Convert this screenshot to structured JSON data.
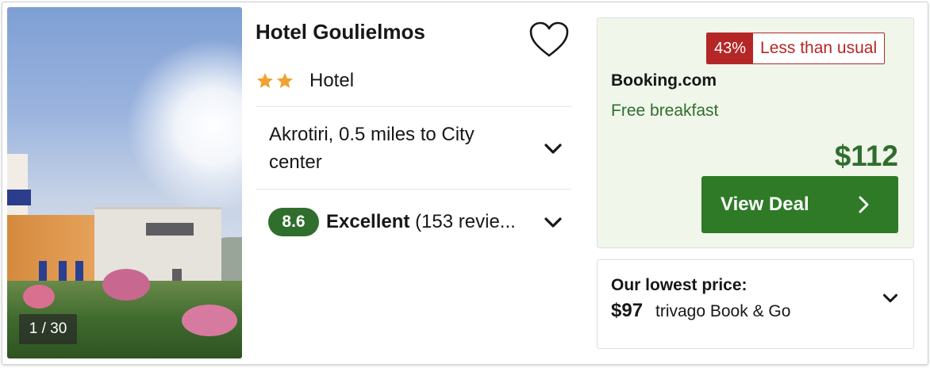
{
  "photo": {
    "counter": "1 / 30"
  },
  "hotel": {
    "name": "Hotel Goulielmos",
    "stars": 2,
    "type": "Hotel",
    "location": "Akrotiri, 0.5 miles to City center",
    "rating": {
      "score": "8.6",
      "label": "Excellent",
      "reviews": "(153 revie..."
    }
  },
  "deal": {
    "discount_pct": "43%",
    "discount_text": "Less than usual",
    "provider": "Booking.com",
    "perk": "Free breakfast",
    "price": "$112",
    "button_label": "View Deal"
  },
  "lowest": {
    "label": "Our lowest price:",
    "price": "$97",
    "source": "trivago Book & Go"
  },
  "colors": {
    "price_green": "#2f6e2d",
    "button_green": "#2f7a27",
    "badge_red": "#b52626",
    "star_orange": "#f2a230",
    "deal_bg": "#f0f6ea"
  },
  "icons": [
    "heart-icon",
    "star-icon",
    "chevron-down-icon",
    "chevron-right-icon"
  ]
}
